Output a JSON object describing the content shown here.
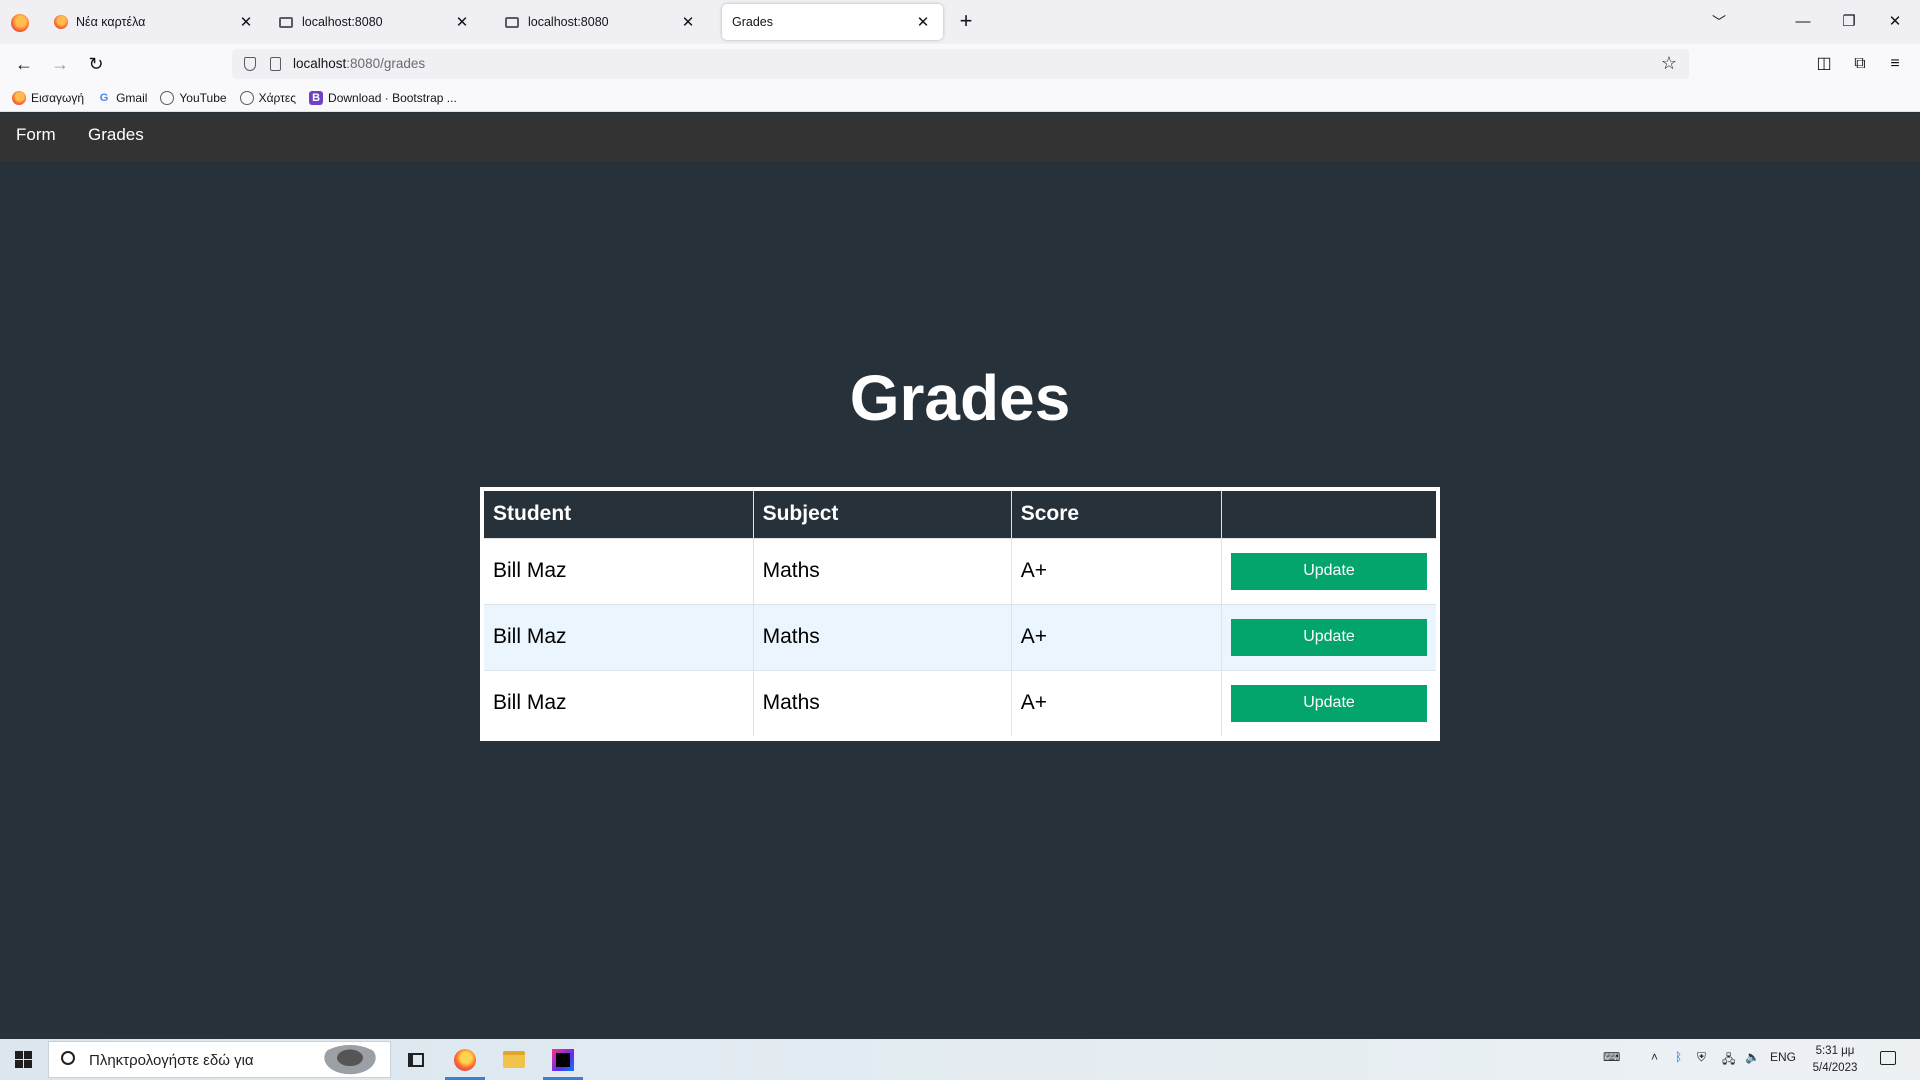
{
  "browser": {
    "tabs": [
      {
        "label": "Νέα καρτέλα",
        "icon": "firefox-icon",
        "active": false
      },
      {
        "label": "localhost:8080",
        "icon": "page-icon",
        "active": false
      },
      {
        "label": "localhost:8080",
        "icon": "page-icon",
        "active": false
      },
      {
        "label": "Grades",
        "icon": "none",
        "active": true
      }
    ],
    "tab_close": "✕",
    "new_tab": "+",
    "url_host": "localhost",
    "url_rest": ":8080/grades",
    "bookmarks": [
      {
        "label": "Εισαγωγή",
        "icon": "firefox-icon"
      },
      {
        "label": "Gmail",
        "icon": "google-icon",
        "glyph": "G"
      },
      {
        "label": "YouTube",
        "icon": "globe-icon"
      },
      {
        "label": "Χάρτες",
        "icon": "globe-icon"
      },
      {
        "label": "Download · Bootstrap ...",
        "icon": "bootstrap-icon",
        "glyph": "B"
      }
    ]
  },
  "app": {
    "nav": [
      "Form",
      "Grades"
    ],
    "title": "Grades",
    "table": {
      "headers": [
        "Student",
        "Subject",
        "Score",
        ""
      ],
      "rows": [
        {
          "student": "Bill Maz",
          "subject": "Maths",
          "score": "A+",
          "action": "Update"
        },
        {
          "student": "Bill Maz",
          "subject": "Maths",
          "score": "A+",
          "action": "Update"
        },
        {
          "student": "Bill Maz",
          "subject": "Maths",
          "score": "A+",
          "action": "Update"
        }
      ]
    },
    "colors": {
      "page_bg": "#27313a",
      "nav_bg": "#333333",
      "button": "#04a46d",
      "alt_row": "#eaf5fd"
    }
  },
  "taskbar": {
    "search_placeholder": "Πληκτρολογήστε εδώ για",
    "lang": "ENG",
    "time": "5:31 μμ",
    "date": "5/4/2023"
  }
}
